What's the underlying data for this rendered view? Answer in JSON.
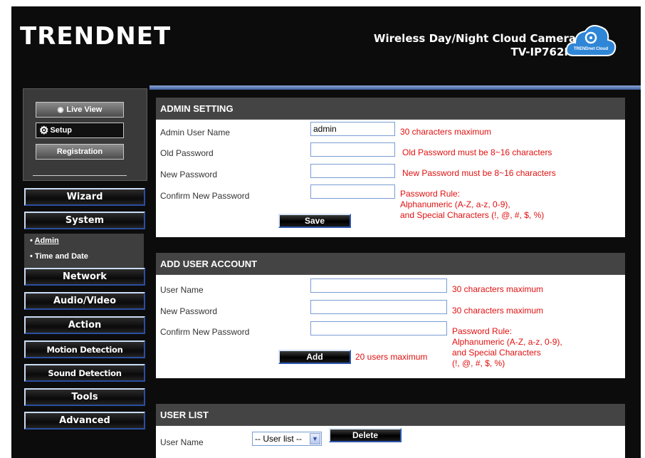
{
  "header": {
    "logo": "TRENDNET",
    "product_name": "Wireless Day/Night Cloud Camera",
    "model": "TV-IP762IC",
    "cloud_badge": "TRENDnet Cloud"
  },
  "sidebar": {
    "buttons": {
      "live_view": "Live View",
      "setup": "Setup",
      "registration": "Registration"
    },
    "menu": {
      "wizard": "Wizard",
      "system": "System",
      "network": "Network",
      "audio_video": "Audio/Video",
      "action": "Action",
      "motion_detection": "Motion Detection",
      "sound_detection": "Sound Detection",
      "tools": "Tools",
      "advanced": "Advanced"
    },
    "system_submenu": {
      "admin": "Admin",
      "time_and_date": "Time and Date"
    }
  },
  "admin_setting": {
    "title": "ADMIN SETTING",
    "labels": {
      "admin_user_name": "Admin User Name",
      "old_password": "Old Password",
      "new_password": "New Password",
      "confirm_new_password": "Confirm New Password"
    },
    "values": {
      "admin_user_name": "admin",
      "old_password": "",
      "new_password": "",
      "confirm_new_password": ""
    },
    "notes": {
      "name_max": "30 characters maximum",
      "old_pw": "Old Password must be 8~16 characters",
      "new_pw": "New Password must be 8~16 characters",
      "rule_1": "Password Rule:",
      "rule_2": "Alphanumeric (A-Z, a-z, 0-9),",
      "rule_3": "and Special Characters  (!, @, #, $, %)"
    },
    "save_label": "Save"
  },
  "add_user": {
    "title": "ADD USER ACCOUNT",
    "labels": {
      "user_name": "User Name",
      "new_password": "New Password",
      "confirm_new_password": "Confirm New Password"
    },
    "values": {
      "user_name": "",
      "new_password": "",
      "confirm_new_password": ""
    },
    "notes": {
      "name_max": "30 characters maximum",
      "pw_max": "30 characters maximum",
      "rule_1": "Password Rule:",
      "rule_2": "Alphanumeric (A-Z, a-z, 0-9),",
      "rule_3": "and Special Characters",
      "rule_4": "(!, @, #, $, %)",
      "users_max": "20 users maximum"
    },
    "add_label": "Add"
  },
  "user_list": {
    "title": "USER LIST",
    "label": "User Name",
    "select_value": "-- User list --",
    "delete_label": "Delete"
  },
  "colors": {
    "accent_blue": "#2c56ae",
    "note_red": "#e01010",
    "section_header": "#444444"
  }
}
